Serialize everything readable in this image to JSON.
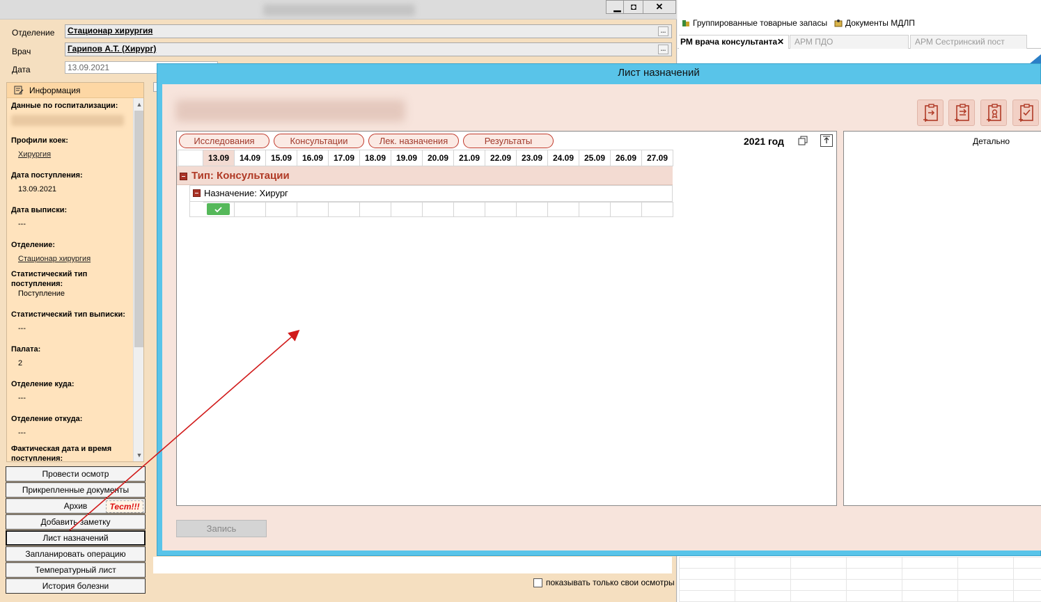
{
  "main_window": {
    "header": {
      "department_label": "Отделение",
      "department_value": "Стационар хирургия",
      "doctor_label": "Врач",
      "doctor_value": "Гарипов А.Т. (Хирург)",
      "date_label": "Дата",
      "date_value": "13.09.2021",
      "dots": "..."
    },
    "window_buttons": {
      "minimize": "▁",
      "maximize": "◘",
      "close": "✕"
    },
    "info_panel": {
      "title": "Информация",
      "fields": [
        {
          "label": "Данные по госпитализации:",
          "value": ""
        },
        {
          "label": "Профили коек:",
          "value": "Хирургия"
        },
        {
          "label": "Дата поступления:",
          "value": "13.09.2021"
        },
        {
          "label": "Дата выписки:",
          "value": "---"
        },
        {
          "label": "Отделение:",
          "value": "Стационар хирургия"
        },
        {
          "label": "Статистический тип поступления:",
          "value": "Поступление"
        },
        {
          "label": "Статистический тип выписки:",
          "value": "---"
        },
        {
          "label": "Палата:",
          "value": "2"
        },
        {
          "label": "Отделение куда:",
          "value": "---"
        },
        {
          "label": "Отделение откуда:",
          "value": "---"
        },
        {
          "label": "Фактическая дата и время поступления:",
          "value": ""
        }
      ]
    },
    "actions": [
      "Провести осмотр",
      "Прикрепленные документы",
      "Архив",
      "Добавить заметку",
      "Лист назначений",
      "Запланировать операцию",
      "Температурный лист",
      "История болезни"
    ],
    "test_badge": "Тест!!!",
    "show_own_label": "показывать только свои осмотры"
  },
  "right_app": {
    "toolbar": [
      "Группированные товарные запасы",
      "Документы МДЛП"
    ],
    "tabs": [
      {
        "label": "РМ врача консультанта",
        "close": "✕"
      },
      {
        "label": "АРМ ПДО"
      },
      {
        "label": "АРМ Сестринский пост"
      }
    ]
  },
  "dialog": {
    "title": "Лист назначений",
    "filter_tabs": [
      "Исследования",
      "Консультации",
      "Лек. назначения",
      "Результаты"
    ],
    "year": "2021 год",
    "dates": [
      "13.09",
      "14.09",
      "15.09",
      "16.09",
      "17.09",
      "18.09",
      "19.09",
      "20.09",
      "21.09",
      "22.09",
      "23.09",
      "24.09",
      "25.09",
      "26.09",
      "27.09"
    ],
    "group_type": "Тип: Консультации",
    "assignment": "Назначение: Хирург",
    "done_marks": [
      true,
      false,
      false,
      false,
      false,
      false,
      false,
      false,
      false,
      false,
      false,
      false,
      false,
      false,
      false
    ],
    "detail_label": "Детально",
    "save_button": "Запись",
    "toolbar_icons": [
      "clipboard-import-icon",
      "clipboard-export-icon",
      "clipboard-certificate-icon",
      "clipboard-check-icon"
    ]
  },
  "colors": {
    "dialog_frame": "#59c4e9",
    "dialog_body": "#f7e4dc",
    "accent_red": "#b03a26",
    "done_green": "#55b85a",
    "info_panel": "#ffe3bd"
  }
}
